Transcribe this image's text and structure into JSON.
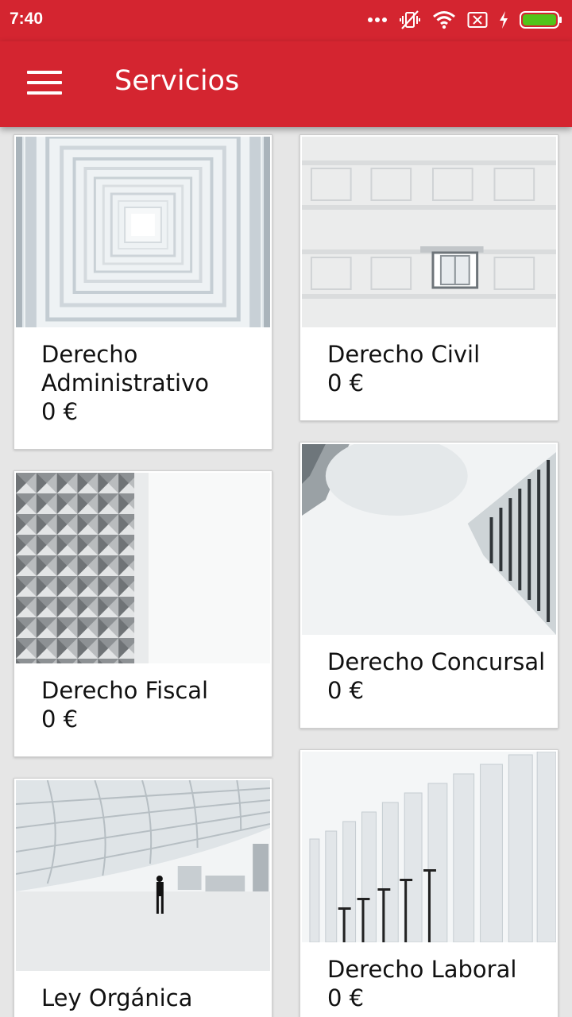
{
  "status": {
    "time": "7:40",
    "icons": [
      "more-dots-icon",
      "vibrate-off-icon",
      "wifi-icon",
      "no-sim-icon",
      "charging-icon",
      "battery-icon"
    ]
  },
  "app_bar": {
    "title": "Servicios",
    "menu_icon": "hamburger-menu-icon"
  },
  "colors": {
    "primary": "#d42530",
    "background": "#e6e6e6",
    "card": "#ffffff"
  },
  "services": [
    {
      "title": "Derecho Administrativo",
      "price": "0 €"
    },
    {
      "title": "Derecho Civil",
      "price": "0 €"
    },
    {
      "title": "Derecho Fiscal",
      "price": "0 €"
    },
    {
      "title": "Derecho Concursal",
      "price": "0 €"
    },
    {
      "title": "Ley Orgánica",
      "price": ""
    },
    {
      "title": "Derecho Laboral",
      "price": "0 €"
    }
  ]
}
